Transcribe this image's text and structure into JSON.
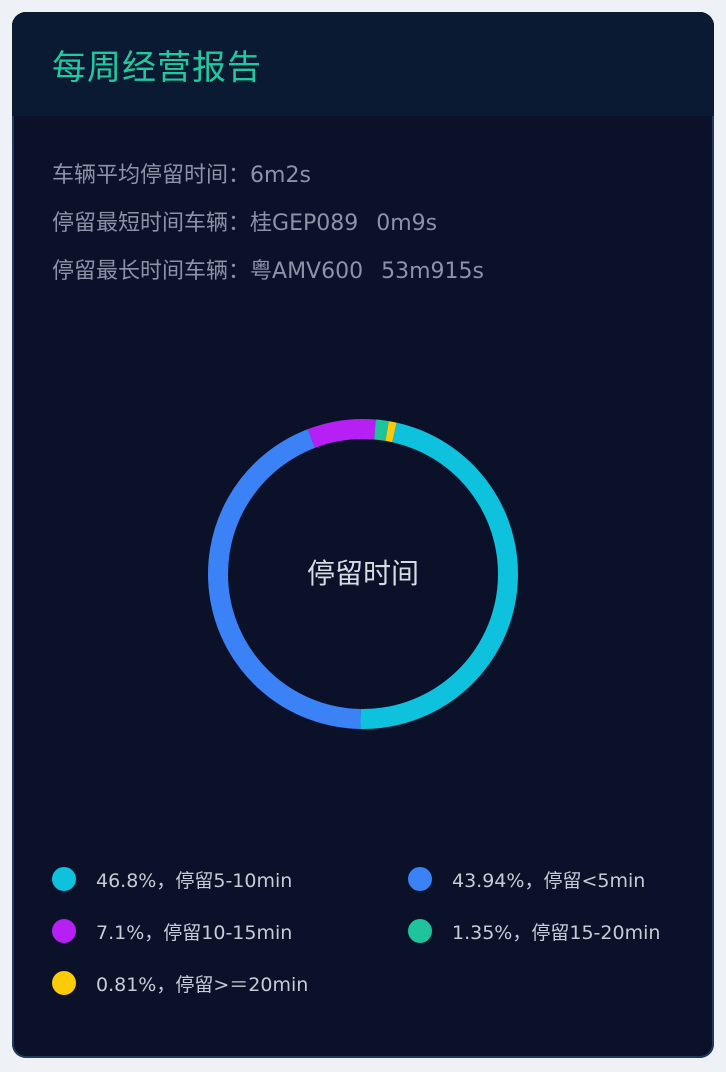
{
  "header": {
    "title": "每周经营报告"
  },
  "stats": {
    "avg_label": "车辆平均停留时间：",
    "avg_value": "6m2s",
    "shortest_label": "停留最短时间车辆：",
    "shortest_plate": "桂GEP089",
    "shortest_value": "0m9s",
    "longest_label": "停留最长时间车辆：",
    "longest_plate": "粤AMV600",
    "longest_value": "53m915s"
  },
  "chart_data": {
    "type": "pie",
    "title": "停留时间",
    "slices": [
      {
        "label": "46.8%，停留5-10min",
        "value": 46.8,
        "color": "#0ec1dc"
      },
      {
        "label": "43.94%，停留<5min",
        "value": 43.94,
        "color": "#3b82f6"
      },
      {
        "label": "7.1%，停留10-15min",
        "value": 7.1,
        "color": "#b620f5"
      },
      {
        "label": "1.35%，停留15-20min",
        "value": 1.35,
        "color": "#1fc49d"
      },
      {
        "label": "0.81%，停留>＝20min",
        "value": 0.81,
        "color": "#fbcb0a"
      }
    ],
    "legend_placement": "bottom"
  },
  "legend": [
    {
      "text": "46.8%，停留5-10min",
      "color": "#0ec1dc"
    },
    {
      "text": "43.94%，停留<5min",
      "color": "#3b82f6"
    },
    {
      "text": "7.1%，停留10-15min",
      "color": "#b620f5"
    },
    {
      "text": "1.35%，停留15-20min",
      "color": "#1fc49d"
    },
    {
      "text": "0.81%，停留>＝20min",
      "color": "#fbcb0a"
    }
  ]
}
